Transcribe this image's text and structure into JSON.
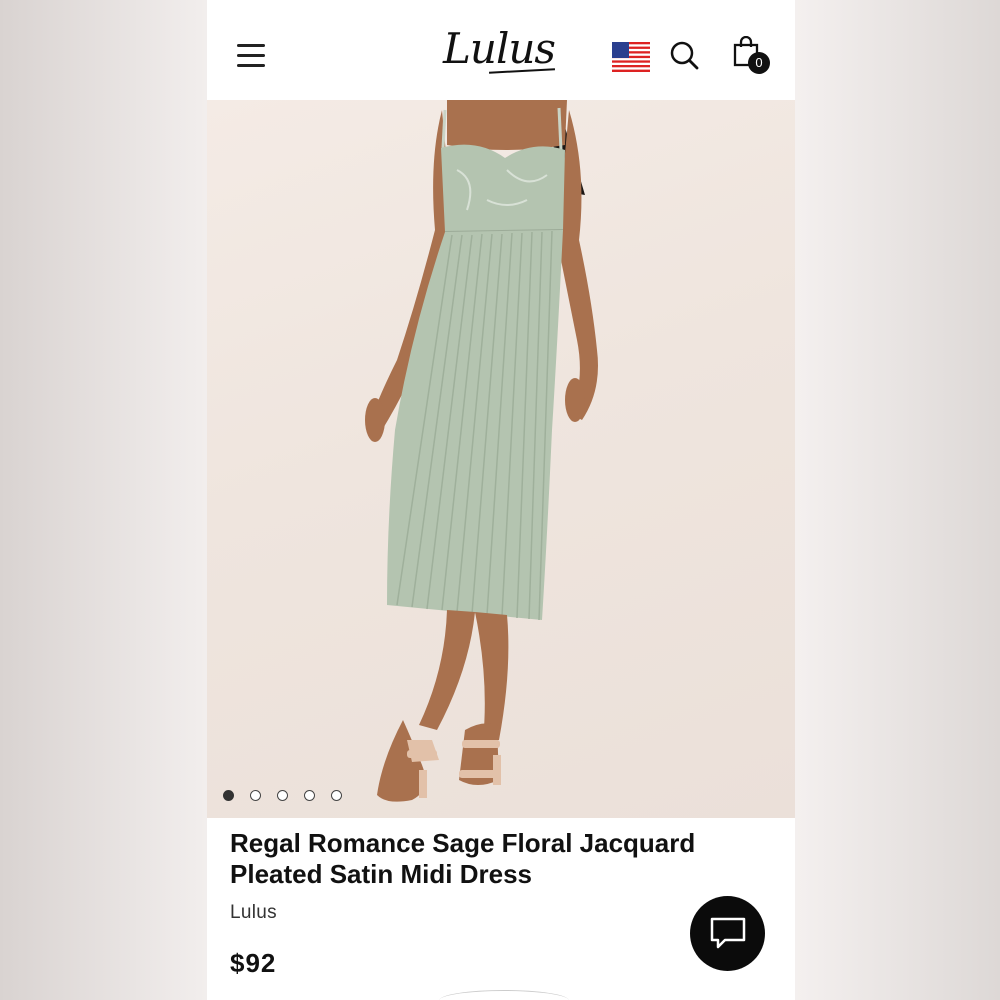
{
  "header": {
    "logo_text": "Lulus",
    "cart_count": "0",
    "icons": [
      "menu-icon",
      "us-flag-icon",
      "search-icon",
      "shopping-bag-icon"
    ]
  },
  "product": {
    "title": "Regal Romance Sage Floral Jacquard Pleated Satin Midi Dress",
    "brand": "Lulus",
    "price": "$92",
    "image_count": 5,
    "active_image_index": 0
  },
  "chat": {
    "icon": "chat-bubble-icon"
  },
  "colors": {
    "dress": "#b4c4b0",
    "background": "#efe5de",
    "text": "#111111"
  }
}
